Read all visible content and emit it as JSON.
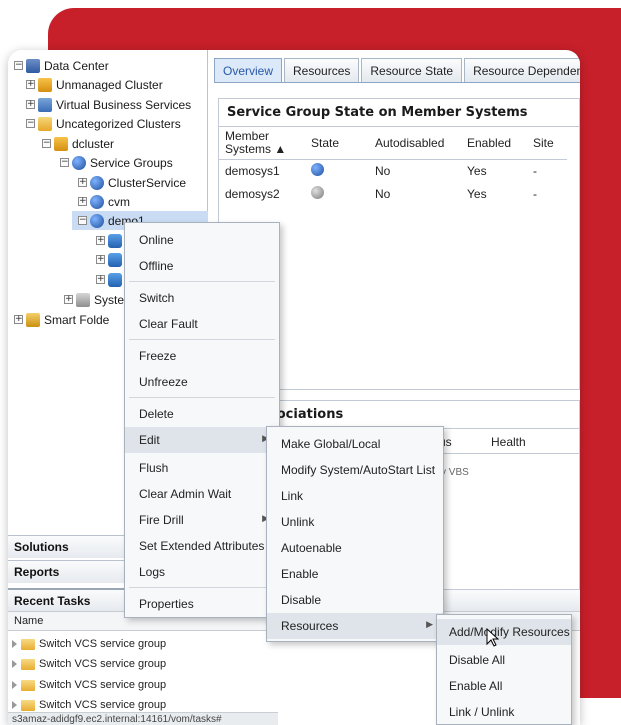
{
  "tree": {
    "items": [
      {
        "label": "Data Center",
        "expander": "−",
        "icon": "datacenter-icon"
      },
      {
        "label": "Unmanaged Cluster",
        "expander": "+",
        "icon": "cluster-icon"
      },
      {
        "label": "Virtual Business Services",
        "expander": "+",
        "icon": "vbs-icon"
      },
      {
        "label": "Uncategorized Clusters",
        "expander": "−",
        "icon": "folder-icon"
      },
      {
        "label": "dcluster",
        "expander": "−",
        "icon": "cluster-icon"
      },
      {
        "label": "Service Groups",
        "expander": "−",
        "icon": "service-groups-icon"
      },
      {
        "label": "ClusterService",
        "expander": "+",
        "icon": "service-group-icon"
      },
      {
        "label": "cvm",
        "expander": "+",
        "icon": "service-group-icon"
      },
      {
        "label": "demo1",
        "expander": "−",
        "icon": "service-group-icon"
      },
      {
        "label": "",
        "expander": "+",
        "icon": "resource-icon"
      },
      {
        "label": "",
        "expander": "+",
        "icon": "resource-icon"
      },
      {
        "label": "",
        "expander": "+",
        "icon": "resource-icon"
      },
      {
        "label": "Syste",
        "expander": "+",
        "icon": "systems-icon"
      },
      {
        "label": "Smart Folde",
        "expander": "+",
        "icon": "smart-folder-icon"
      }
    ]
  },
  "sidebar_sections": {
    "solutions": "Solutions",
    "reports": "Reports",
    "recent_tasks": "Recent Tasks"
  },
  "tasks": {
    "column_name": "Name",
    "rows": [
      "Switch VCS service group",
      "Switch VCS service group",
      "Switch VCS service group",
      "Switch VCS service group"
    ]
  },
  "status_bar": "s3amaz-adidgf9.ec2.internal:14161/vom/tasks#",
  "tabs": [
    {
      "label": "Overview",
      "active": true
    },
    {
      "label": "Resources",
      "active": false
    },
    {
      "label": "Resource State",
      "active": false
    },
    {
      "label": "Resource Dependency",
      "active": false
    }
  ],
  "state_panel": {
    "title": "Service Group State on Member Systems",
    "columns": [
      "Member Systems ▲",
      "State",
      "Autodisabled",
      "Enabled",
      "Site"
    ],
    "rows": [
      {
        "system": "demosys1",
        "state_icon": "online-state-icon",
        "autodisabled": "No",
        "enabled": "Yes",
        "site": "-"
      },
      {
        "system": "demosys2",
        "state_icon": "offline-state-icon",
        "autodisabled": "No",
        "enabled": "Yes",
        "site": "-"
      }
    ]
  },
  "assoc_panel": {
    "title_fragment": "sociations",
    "col_status": "us",
    "col_health": "Health",
    "note": "y VBS"
  },
  "context_menu": {
    "items": [
      "Online",
      "Offline",
      "Switch",
      "Clear Fault",
      "Freeze",
      "Unfreeze",
      "Delete",
      "Edit",
      "Flush",
      "Clear Admin Wait",
      "Fire Drill",
      "Set Extended Attributes",
      "Logs",
      "Properties"
    ]
  },
  "edit_submenu": {
    "items": [
      "Make Global/Local",
      "Modify System/AutoStart List",
      "Link",
      "Unlink",
      "Autoenable",
      "Enable",
      "Disable",
      "Resources"
    ]
  },
  "resources_submenu": {
    "items": [
      "Add/Modify Resources",
      "Disable All",
      "Enable All",
      "Link / Unlink"
    ]
  },
  "colors": {
    "accent_red": "#c8202a",
    "tab_active": "#2a58a8",
    "selection": "#c9dcf4"
  }
}
